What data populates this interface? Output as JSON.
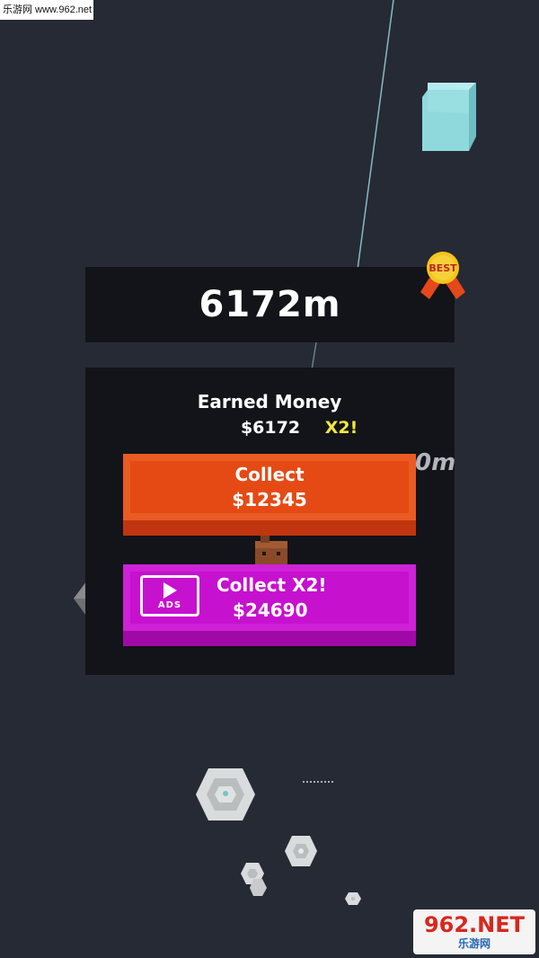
{
  "watermark_top": {
    "text": "乐游网 www.962.net"
  },
  "distance": {
    "value": "6172m",
    "best_badge": "BEST"
  },
  "reward": {
    "title": "Earned Money",
    "amount": "$6172",
    "multiplier": "X2!",
    "ghost_distance_text": "0m"
  },
  "buttons": {
    "collect": {
      "label": "Collect",
      "amount": "$12345"
    },
    "collect_x2": {
      "label": "Collect X2!",
      "amount": "$24690",
      "ads_label": "ADS"
    }
  },
  "watermark_bottom": {
    "main": "962.NET",
    "sub": "乐游网"
  },
  "colors": {
    "background": "#262a35",
    "panel": "#121419",
    "collect_button": "#e54a15",
    "collect_x2_button": "#c611cf",
    "multiplier": "#f3e73a",
    "badge_gold": "#f5c51a",
    "badge_ribbon": "#e4481b"
  },
  "icons": [
    "play-ads-icon",
    "best-badge-icon",
    "cube-obstacle",
    "hexagon-obstacle",
    "player-character"
  ]
}
